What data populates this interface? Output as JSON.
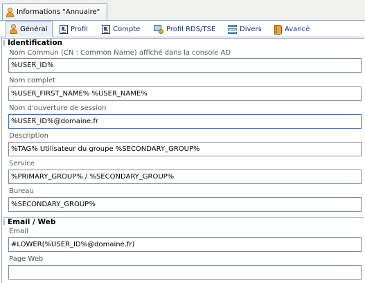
{
  "window_tab": {
    "title": "Informations \"Annuaire\"",
    "icon": "user-icon"
  },
  "tabs": [
    {
      "label": "Général",
      "icon": "user-icon",
      "active": true
    },
    {
      "label": "Profil",
      "icon": "card-icon",
      "active": false
    },
    {
      "label": "Compte",
      "icon": "card-icon",
      "active": false
    },
    {
      "label": "Profil RDS/TSE",
      "icon": "remote-desktop-icon",
      "active": false
    },
    {
      "label": "Divers",
      "icon": "list-icon",
      "active": false
    },
    {
      "label": "Avancé",
      "icon": "book-icon",
      "active": false
    }
  ],
  "sections": {
    "identification": "Identification",
    "email_web": "Email / Web"
  },
  "fields": {
    "common_name": {
      "label": "Nom Commun (CN : Common Name) affiché dans la console AD",
      "value": "%USER_ID%"
    },
    "full_name": {
      "label": "Nom complet",
      "value": "%USER_FIRST_NAME% %USER_NAME%"
    },
    "logon_name": {
      "label": "Nom d'ouverture de session",
      "value": "%USER_ID%@domaine.fr"
    },
    "description": {
      "label": "Description",
      "value": "%TAG% Utilisateur du groupe %SECONDARY_GROUP%"
    },
    "service": {
      "label": "Service",
      "value": "%PRIMARY_GROUP% / %SECONDARY_GROUP%"
    },
    "office": {
      "label": "Bureau",
      "value": "%SECONDARY_GROUP%"
    },
    "email": {
      "label": "Email",
      "value": "#LOWER(%USER_ID%@domaine.fr)"
    },
    "web_page": {
      "label": "Page Web",
      "value": ""
    }
  },
  "colors": {
    "tab_border": "#8fa3bf",
    "active_tab_bg": "#eaf0fb",
    "tab_text": "#1c2f73"
  }
}
